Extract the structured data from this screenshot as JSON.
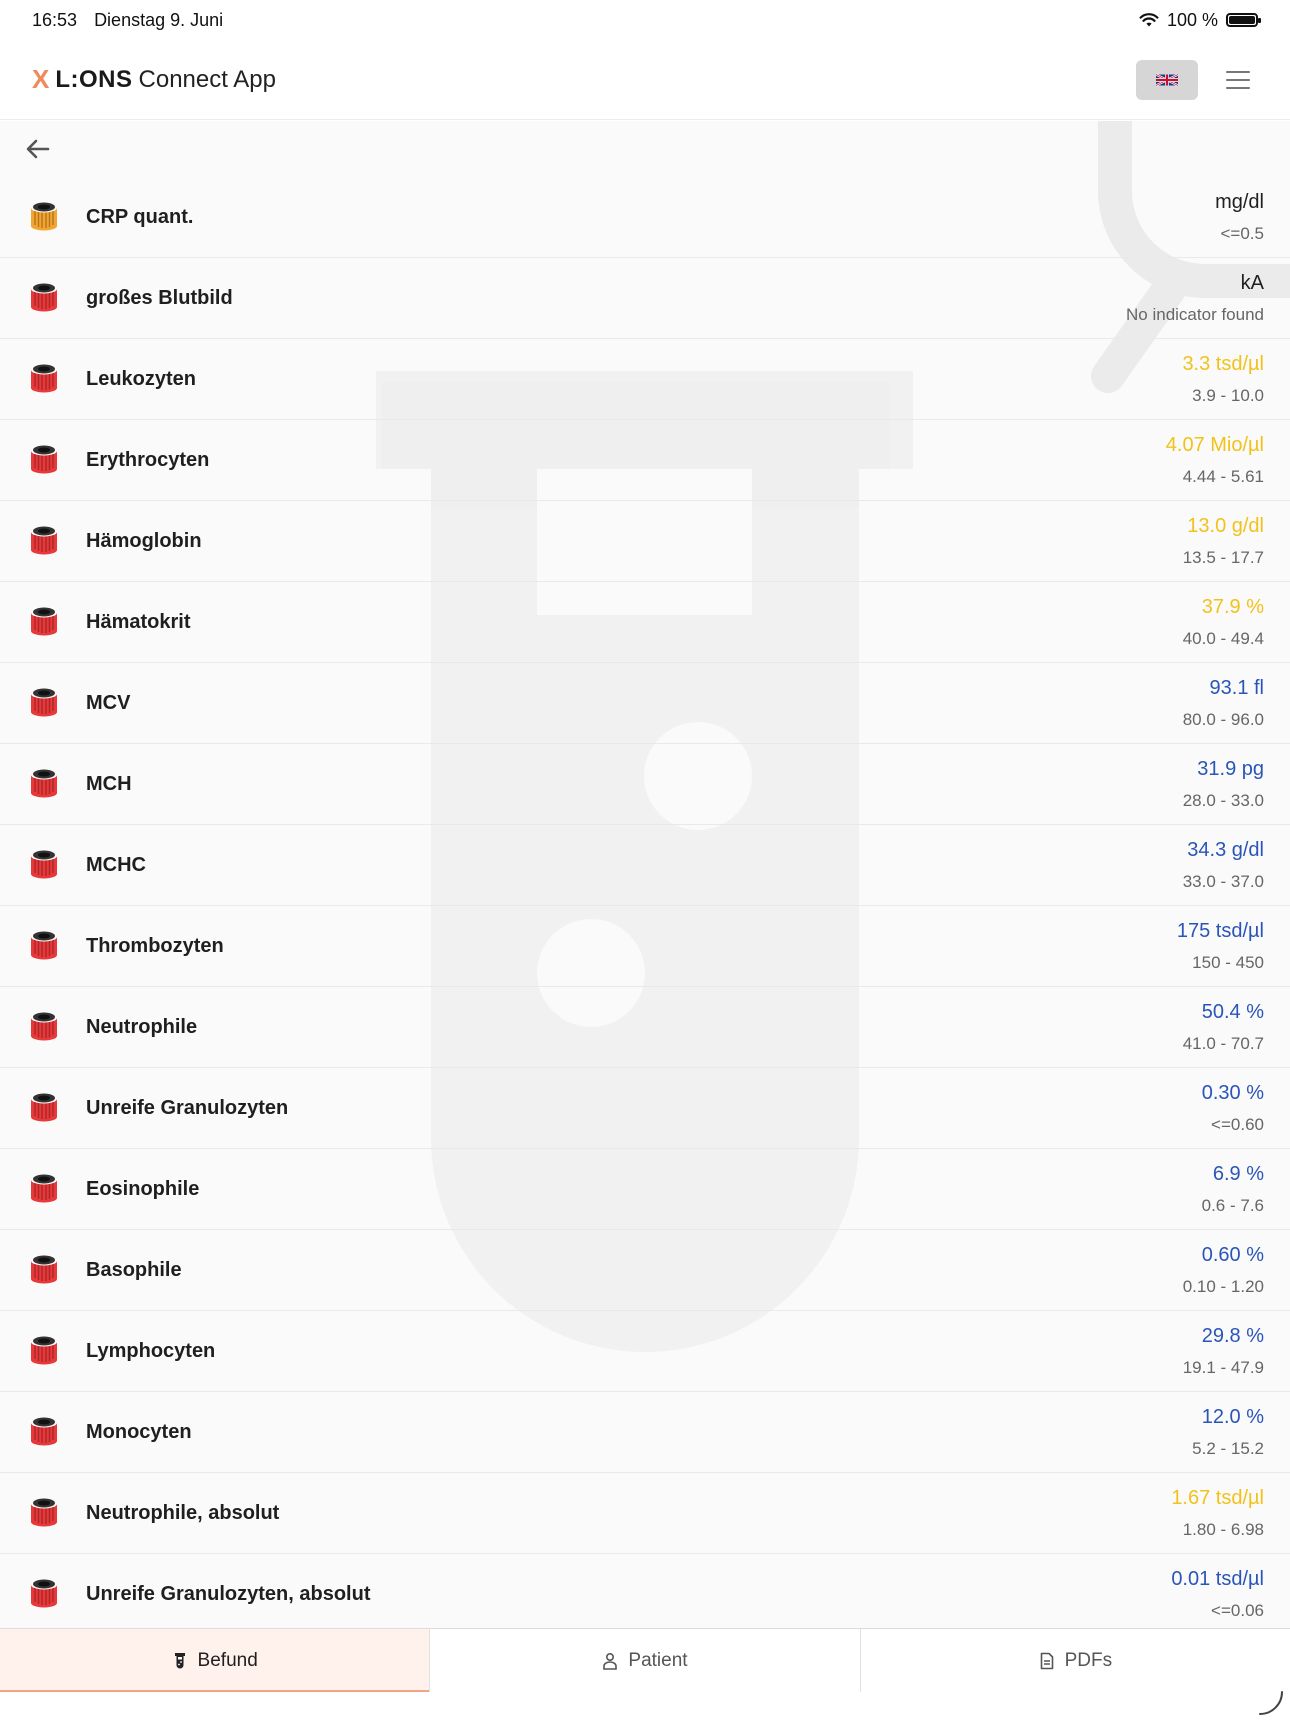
{
  "status_bar": {
    "time": "16:53",
    "date": "Dienstag 9. Juni",
    "battery": "100 %",
    "battery_level": 100
  },
  "header": {
    "logo_brand": "L:ONS",
    "logo_rest": "Connect App",
    "language_icon": "uk-flag-icon",
    "menu_icon": "hamburger-menu-icon"
  },
  "colors": {
    "accent": "#f08a5d",
    "low_value": "#f2c21b",
    "normal_value": "#2a55b8",
    "tube_orange": "#f3a52f",
    "tube_red": "#e8383a"
  },
  "results": [
    {
      "name": "CRP quant.",
      "value": "mg/dl",
      "range": "<=0.5",
      "status": "neutral",
      "tube": "orange"
    },
    {
      "name": "großes Blutbild",
      "value": "kA",
      "range": "No indicator found",
      "status": "neutral",
      "tube": "red"
    },
    {
      "name": "Leukozyten",
      "value": "3.3 tsd/µl",
      "range": "3.9 - 10.0",
      "status": "low",
      "tube": "red"
    },
    {
      "name": "Erythrocyten",
      "value": "4.07 Mio/µl",
      "range": "4.44 - 5.61",
      "status": "low",
      "tube": "red"
    },
    {
      "name": "Hämoglobin",
      "value": "13.0 g/dl",
      "range": "13.5 - 17.7",
      "status": "low",
      "tube": "red"
    },
    {
      "name": "Hämatokrit",
      "value": "37.9 %",
      "range": "40.0 - 49.4",
      "status": "low",
      "tube": "red"
    },
    {
      "name": "MCV",
      "value": "93.1 fl",
      "range": "80.0 - 96.0",
      "status": "normal",
      "tube": "red"
    },
    {
      "name": "MCH",
      "value": "31.9 pg",
      "range": "28.0 - 33.0",
      "status": "normal",
      "tube": "red"
    },
    {
      "name": "MCHC",
      "value": "34.3 g/dl",
      "range": "33.0 - 37.0",
      "status": "normal",
      "tube": "red"
    },
    {
      "name": "Thrombozyten",
      "value": "175 tsd/µl",
      "range": "150 - 450",
      "status": "normal",
      "tube": "red"
    },
    {
      "name": "Neutrophile",
      "value": "50.4 %",
      "range": "41.0 - 70.7",
      "status": "normal",
      "tube": "red"
    },
    {
      "name": "Unreife Granulozyten",
      "value": "0.30 %",
      "range": "<=0.60",
      "status": "normal",
      "tube": "red"
    },
    {
      "name": "Eosinophile",
      "value": "6.9 %",
      "range": "0.6 - 7.6",
      "status": "normal",
      "tube": "red"
    },
    {
      "name": "Basophile",
      "value": "0.60 %",
      "range": "0.10 - 1.20",
      "status": "normal",
      "tube": "red"
    },
    {
      "name": "Lymphocyten",
      "value": "29.8 %",
      "range": "19.1 - 47.9",
      "status": "normal",
      "tube": "red"
    },
    {
      "name": "Monocyten",
      "value": "12.0 %",
      "range": "5.2 - 15.2",
      "status": "normal",
      "tube": "red"
    },
    {
      "name": "Neutrophile, absolut",
      "value": "1.67 tsd/µl",
      "range": "1.80 - 6.98",
      "status": "low",
      "tube": "red"
    },
    {
      "name": "Unreife Granulozyten, absolut",
      "value": "0.01 tsd/µl",
      "range": "<=0.06",
      "status": "normal",
      "tube": "red"
    }
  ],
  "tabs": [
    {
      "label": "Befund",
      "icon": "test-tube-icon",
      "active": true
    },
    {
      "label": "Patient",
      "icon": "person-icon",
      "active": false
    },
    {
      "label": "PDFs",
      "icon": "document-icon",
      "active": false
    }
  ]
}
